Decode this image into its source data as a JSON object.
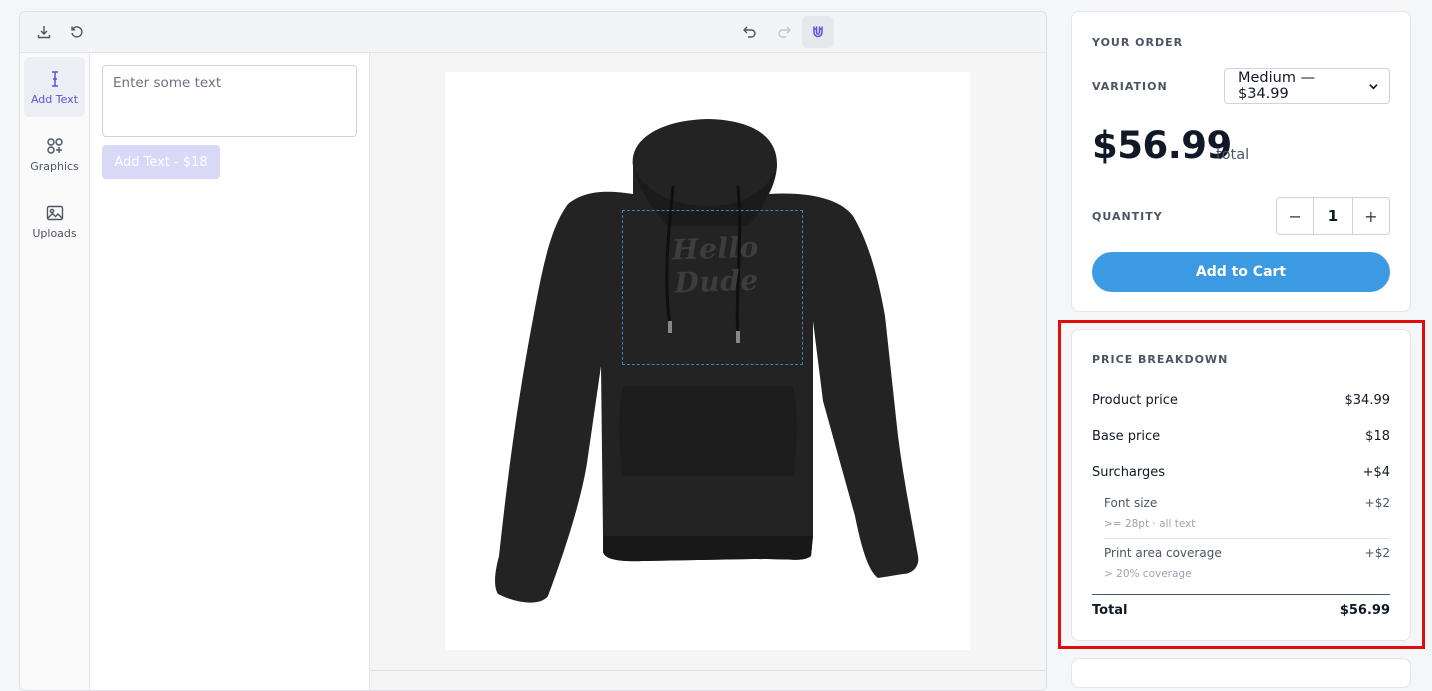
{
  "rail": {
    "items": [
      {
        "label": "Add Text",
        "icon": "text-cursor-icon"
      },
      {
        "label": "Graphics",
        "icon": "shapes-icon"
      },
      {
        "label": "Uploads",
        "icon": "image-icon"
      }
    ]
  },
  "panel": {
    "text_placeholder": "Enter some text",
    "add_button_label": "Add Text - $18"
  },
  "canvas": {
    "design_text": "Hello Dude"
  },
  "order": {
    "heading": "YOUR ORDER",
    "variation_label": "VARIATION",
    "variation_value": "Medium — $34.99",
    "total_price": "$56.99",
    "total_suffix": "total",
    "quantity_label": "QUANTITY",
    "quantity_value": "1",
    "minus": "−",
    "plus": "+",
    "cart_button": "Add to Cart"
  },
  "breakdown": {
    "heading": "PRICE BREAKDOWN",
    "product_price_label": "Product price",
    "product_price_value": "$34.99",
    "base_price_label": "Base price",
    "base_price_value": "$18",
    "surcharges_label": "Surcharges",
    "surcharges_value": "+$4",
    "font_size_label": "Font size",
    "font_size_value": "+$2",
    "font_size_note": ">= 28pt · all text",
    "coverage_label": "Print area coverage",
    "coverage_value": "+$2",
    "coverage_note": "> 20% coverage",
    "total_label": "Total",
    "total_value": "$56.99"
  },
  "colors": {
    "accent": "#5b52d6",
    "cart_button": "#3b9ae1",
    "highlight": "#e00d0d"
  }
}
